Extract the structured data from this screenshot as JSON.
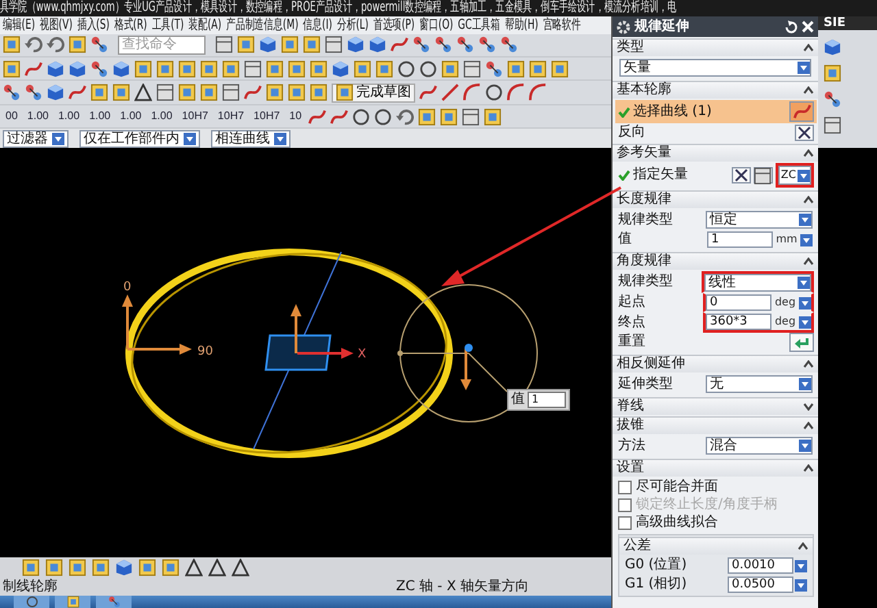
{
  "title_bar": {
    "text": "具学院（www.qhmjxy.com）专业UG产品设计，模具设计，数控编程，PROE产品设计，powermill数控编程，五轴加工，五金模具，倒车手绘设计，模流分析培训，电"
  },
  "menu_bar": {
    "items": [
      "编辑(E)",
      "视图(V)",
      "插入(S)",
      "格式(R)",
      "工具(T)",
      "装配(A)",
      "产品制造信息(M)",
      "信息(I)",
      "分析(L)",
      "首选项(P)",
      "窗口(O)",
      "GC工具箱",
      "帮助(H)",
      "宫略软件"
    ]
  },
  "toolbar": {
    "search": {
      "placeholder": "查找命令"
    },
    "finish_sketch": "完成草图",
    "dimension_styles": [
      "00",
      "1.00",
      "1.00",
      "1.00",
      "1.00",
      "1.00",
      "10H7",
      "10H7",
      "10H7",
      "10"
    ]
  },
  "selection_bar": {
    "dropdowns": [
      "过滤器",
      "仅在工作部件内",
      "相连曲线"
    ]
  },
  "canvas": {
    "angle_labels": [
      "0",
      "90"
    ],
    "axis_label": "X",
    "value_popup": {
      "label": "值",
      "value": "1"
    }
  },
  "status_bar": {
    "prompt": "制线轮廓",
    "message": "ZC 轴 - X 轴矢量方向"
  },
  "side_strip": {
    "logo_text": "SIE"
  },
  "dialog": {
    "title": "规律延伸",
    "sections": [
      {
        "title": "类型",
        "expanded": true,
        "rows": [
          {
            "kind": "dropdown",
            "value": "矢量"
          }
        ]
      },
      {
        "title": "基本轮廓",
        "expanded": true,
        "rows": [
          {
            "kind": "select",
            "label": "选择曲线 (1)",
            "done": true,
            "active": true
          },
          {
            "kind": "reverse",
            "label": "反向"
          }
        ]
      },
      {
        "title": "参考矢量",
        "expanded": true,
        "rows": [
          {
            "kind": "vector",
            "label": "指定矢量",
            "done": true,
            "value": "ZC",
            "annotated": true
          }
        ]
      },
      {
        "title": "长度规律",
        "expanded": true,
        "rows": [
          {
            "kind": "dropdown",
            "label": "规律类型",
            "value": "恒定"
          },
          {
            "kind": "number",
            "label": "值",
            "value": "1",
            "unit": "mm"
          }
        ]
      },
      {
        "title": "角度规律",
        "expanded": true,
        "rows": [
          {
            "kind": "dropdown",
            "label": "规律类型",
            "value": "线性",
            "annotated": true
          },
          {
            "kind": "number",
            "label": "起点",
            "value": "0",
            "unit": "deg",
            "annotated": true
          },
          {
            "kind": "number",
            "label": "终点",
            "value": "360*3",
            "unit": "deg",
            "annotated": true
          },
          {
            "kind": "reset",
            "label": "重置"
          }
        ]
      },
      {
        "title": "相反侧延伸",
        "expanded": true,
        "rows": [
          {
            "kind": "dropdown",
            "label": "延伸类型",
            "value": "无"
          }
        ]
      },
      {
        "title": "脊线",
        "expanded": false
      },
      {
        "title": "拔锥",
        "expanded": true,
        "rows": [
          {
            "kind": "dropdown",
            "label": "方法",
            "value": "混合"
          }
        ]
      },
      {
        "title": "设置",
        "expanded": true,
        "rows": [
          {
            "kind": "checkbox",
            "label": "尽可能合并面",
            "checked": false,
            "disabled": false
          },
          {
            "kind": "checkbox",
            "label": "锁定终止长度/角度手柄",
            "checked": false,
            "disabled": true
          },
          {
            "kind": "checkbox",
            "label": "高级曲线拟合",
            "checked": false,
            "disabled": false
          }
        ],
        "group": {
          "title": "公差",
          "expanded": true,
          "rows": [
            {
              "kind": "number",
              "label": "G0 (位置)",
              "value": "0.0010"
            },
            {
              "kind": "number",
              "label": "G1 (相切)",
              "value": "0.0500"
            }
          ]
        }
      }
    ]
  }
}
